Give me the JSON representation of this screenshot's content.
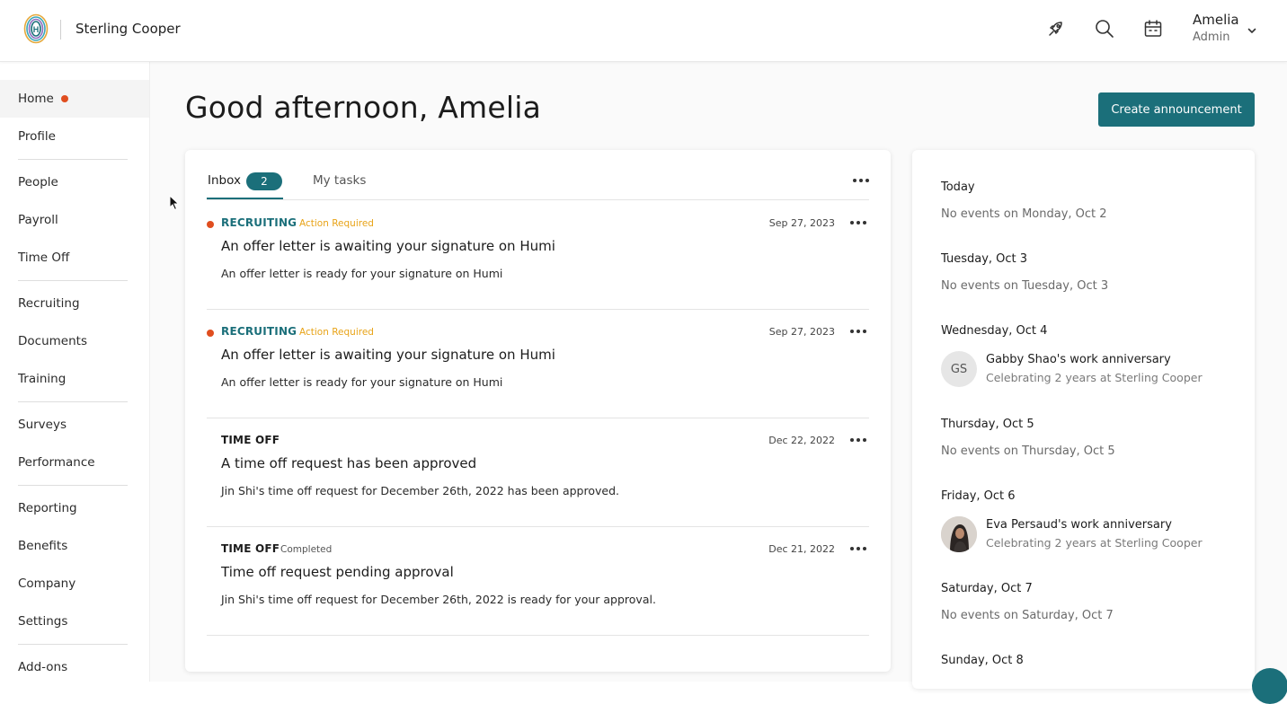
{
  "header": {
    "company_name": "Sterling Cooper",
    "user": {
      "name": "Amelia",
      "role": "Admin"
    },
    "icons": [
      "rocket-icon",
      "search-icon",
      "calendar-icon",
      "chevron-down-icon"
    ]
  },
  "sidebar": {
    "items": [
      {
        "label": "Home",
        "active": true,
        "notification": true
      },
      {
        "label": "Profile"
      },
      {
        "label": "People"
      },
      {
        "label": "Payroll"
      },
      {
        "label": "Time Off"
      },
      {
        "label": "Recruiting"
      },
      {
        "label": "Documents"
      },
      {
        "label": "Training"
      },
      {
        "label": "Surveys"
      },
      {
        "label": "Performance"
      },
      {
        "label": "Reporting"
      },
      {
        "label": "Benefits"
      },
      {
        "label": "Company"
      },
      {
        "label": "Settings"
      },
      {
        "label": "Add-ons"
      }
    ]
  },
  "main": {
    "greeting": "Good afternoon, Amelia",
    "create_button": "Create announcement"
  },
  "inbox": {
    "tabs": {
      "inbox_label": "Inbox",
      "inbox_count": "2",
      "tasks_label": "My tasks"
    },
    "items": [
      {
        "category": "RECRUITING",
        "tag": "Action Required",
        "date": "Sep 27, 2023",
        "title": "An offer letter is awaiting your signature on Humi",
        "body": "An offer letter is ready for your signature on Humi"
      },
      {
        "category": "RECRUITING",
        "tag": "Action Required",
        "date": "Sep 27, 2023",
        "title": "An offer letter is awaiting your signature on Humi",
        "body": "An offer letter is ready for your signature on Humi"
      },
      {
        "category": "TIME OFF",
        "tag": "",
        "date": "Dec 22, 2022",
        "title": "A time off request has been approved",
        "body": "Jin Shi's time off request for December 26th, 2022 has been approved."
      },
      {
        "category": "TIME OFF",
        "tag": "Completed",
        "date": "Dec 21, 2022",
        "title": "Time off request pending approval",
        "body": "Jin Shi's time off request for December 26th, 2022 is ready for your approval."
      }
    ]
  },
  "calendar": {
    "days": [
      {
        "day": "Today",
        "none_text": "No events on Monday, Oct 2"
      },
      {
        "day": "Tuesday, Oct 3",
        "none_text": "No events on Tuesday, Oct 3"
      },
      {
        "day": "Wednesday, Oct 4",
        "event": {
          "initials": "GS",
          "title": "Gabby Shao's work anniversary",
          "subtitle": "Celebrating 2 years at Sterling Cooper"
        }
      },
      {
        "day": "Thursday, Oct 5",
        "none_text": "No events on Thursday, Oct 5"
      },
      {
        "day": "Friday, Oct 6",
        "event": {
          "initials": "",
          "title": "Eva Persaud's work anniversary",
          "subtitle": "Celebrating 2 years at Sterling Cooper"
        }
      },
      {
        "day": "Saturday, Oct 7",
        "none_text": "No events on Saturday, Oct 7"
      },
      {
        "day": "Sunday, Oct 8"
      }
    ]
  },
  "colors": {
    "accent": "#1b6f7a",
    "notification": "#e04e1f",
    "action_required": "#e8a317"
  }
}
